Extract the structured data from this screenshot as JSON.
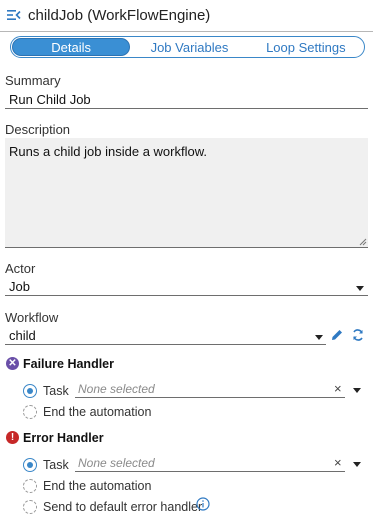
{
  "header": {
    "title": "childJob (WorkFlowEngine)"
  },
  "tabs": [
    {
      "label": "Details",
      "active": true
    },
    {
      "label": "Job Variables",
      "active": false
    },
    {
      "label": "Loop Settings",
      "active": false
    }
  ],
  "summary": {
    "label": "Summary",
    "value": "Run Child Job"
  },
  "description": {
    "label": "Description",
    "value": "Runs a child job inside a workflow."
  },
  "actor": {
    "label": "Actor",
    "value": "Job"
  },
  "workflow": {
    "label": "Workflow",
    "value": "child"
  },
  "failure_handler": {
    "title": "Failure Handler",
    "task_label": "Task",
    "task_placeholder": "None selected",
    "end_label": "End the automation"
  },
  "error_handler": {
    "title": "Error Handler",
    "task_label": "Task",
    "task_placeholder": "None selected",
    "end_label": "End the automation",
    "default_label": "Send to default error handler"
  },
  "icons": {
    "collapse": "collapse-panel-icon",
    "failure": "x-circle-icon",
    "error": "exclamation-circle-icon",
    "edit": "pencil-icon",
    "refresh": "refresh-icon",
    "info": "info-icon"
  },
  "colors": {
    "accent": "#3a87c8",
    "failure_icon": "#6a4fa8",
    "error_icon": "#c62828"
  }
}
